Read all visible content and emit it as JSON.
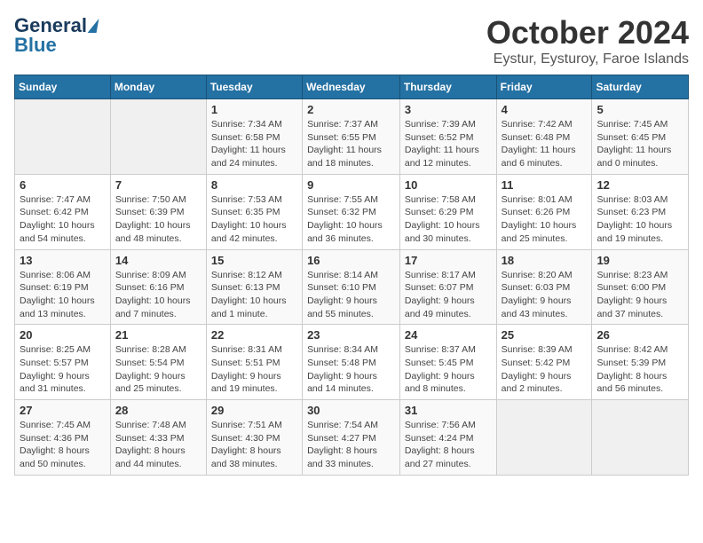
{
  "logo": {
    "line1": "General",
    "line2": "Blue"
  },
  "title": "October 2024",
  "location": "Eystur, Eysturoy, Faroe Islands",
  "weekdays": [
    "Sunday",
    "Monday",
    "Tuesday",
    "Wednesday",
    "Thursday",
    "Friday",
    "Saturday"
  ],
  "weeks": [
    [
      {
        "day": "",
        "info": ""
      },
      {
        "day": "",
        "info": ""
      },
      {
        "day": "1",
        "info": "Sunrise: 7:34 AM\nSunset: 6:58 PM\nDaylight: 11 hours and 24 minutes."
      },
      {
        "day": "2",
        "info": "Sunrise: 7:37 AM\nSunset: 6:55 PM\nDaylight: 11 hours and 18 minutes."
      },
      {
        "day": "3",
        "info": "Sunrise: 7:39 AM\nSunset: 6:52 PM\nDaylight: 11 hours and 12 minutes."
      },
      {
        "day": "4",
        "info": "Sunrise: 7:42 AM\nSunset: 6:48 PM\nDaylight: 11 hours and 6 minutes."
      },
      {
        "day": "5",
        "info": "Sunrise: 7:45 AM\nSunset: 6:45 PM\nDaylight: 11 hours and 0 minutes."
      }
    ],
    [
      {
        "day": "6",
        "info": "Sunrise: 7:47 AM\nSunset: 6:42 PM\nDaylight: 10 hours and 54 minutes."
      },
      {
        "day": "7",
        "info": "Sunrise: 7:50 AM\nSunset: 6:39 PM\nDaylight: 10 hours and 48 minutes."
      },
      {
        "day": "8",
        "info": "Sunrise: 7:53 AM\nSunset: 6:35 PM\nDaylight: 10 hours and 42 minutes."
      },
      {
        "day": "9",
        "info": "Sunrise: 7:55 AM\nSunset: 6:32 PM\nDaylight: 10 hours and 36 minutes."
      },
      {
        "day": "10",
        "info": "Sunrise: 7:58 AM\nSunset: 6:29 PM\nDaylight: 10 hours and 30 minutes."
      },
      {
        "day": "11",
        "info": "Sunrise: 8:01 AM\nSunset: 6:26 PM\nDaylight: 10 hours and 25 minutes."
      },
      {
        "day": "12",
        "info": "Sunrise: 8:03 AM\nSunset: 6:23 PM\nDaylight: 10 hours and 19 minutes."
      }
    ],
    [
      {
        "day": "13",
        "info": "Sunrise: 8:06 AM\nSunset: 6:19 PM\nDaylight: 10 hours and 13 minutes."
      },
      {
        "day": "14",
        "info": "Sunrise: 8:09 AM\nSunset: 6:16 PM\nDaylight: 10 hours and 7 minutes."
      },
      {
        "day": "15",
        "info": "Sunrise: 8:12 AM\nSunset: 6:13 PM\nDaylight: 10 hours and 1 minute."
      },
      {
        "day": "16",
        "info": "Sunrise: 8:14 AM\nSunset: 6:10 PM\nDaylight: 9 hours and 55 minutes."
      },
      {
        "day": "17",
        "info": "Sunrise: 8:17 AM\nSunset: 6:07 PM\nDaylight: 9 hours and 49 minutes."
      },
      {
        "day": "18",
        "info": "Sunrise: 8:20 AM\nSunset: 6:03 PM\nDaylight: 9 hours and 43 minutes."
      },
      {
        "day": "19",
        "info": "Sunrise: 8:23 AM\nSunset: 6:00 PM\nDaylight: 9 hours and 37 minutes."
      }
    ],
    [
      {
        "day": "20",
        "info": "Sunrise: 8:25 AM\nSunset: 5:57 PM\nDaylight: 9 hours and 31 minutes."
      },
      {
        "day": "21",
        "info": "Sunrise: 8:28 AM\nSunset: 5:54 PM\nDaylight: 9 hours and 25 minutes."
      },
      {
        "day": "22",
        "info": "Sunrise: 8:31 AM\nSunset: 5:51 PM\nDaylight: 9 hours and 19 minutes."
      },
      {
        "day": "23",
        "info": "Sunrise: 8:34 AM\nSunset: 5:48 PM\nDaylight: 9 hours and 14 minutes."
      },
      {
        "day": "24",
        "info": "Sunrise: 8:37 AM\nSunset: 5:45 PM\nDaylight: 9 hours and 8 minutes."
      },
      {
        "day": "25",
        "info": "Sunrise: 8:39 AM\nSunset: 5:42 PM\nDaylight: 9 hours and 2 minutes."
      },
      {
        "day": "26",
        "info": "Sunrise: 8:42 AM\nSunset: 5:39 PM\nDaylight: 8 hours and 56 minutes."
      }
    ],
    [
      {
        "day": "27",
        "info": "Sunrise: 7:45 AM\nSunset: 4:36 PM\nDaylight: 8 hours and 50 minutes."
      },
      {
        "day": "28",
        "info": "Sunrise: 7:48 AM\nSunset: 4:33 PM\nDaylight: 8 hours and 44 minutes."
      },
      {
        "day": "29",
        "info": "Sunrise: 7:51 AM\nSunset: 4:30 PM\nDaylight: 8 hours and 38 minutes."
      },
      {
        "day": "30",
        "info": "Sunrise: 7:54 AM\nSunset: 4:27 PM\nDaylight: 8 hours and 33 minutes."
      },
      {
        "day": "31",
        "info": "Sunrise: 7:56 AM\nSunset: 4:24 PM\nDaylight: 8 hours and 27 minutes."
      },
      {
        "day": "",
        "info": ""
      },
      {
        "day": "",
        "info": ""
      }
    ]
  ]
}
